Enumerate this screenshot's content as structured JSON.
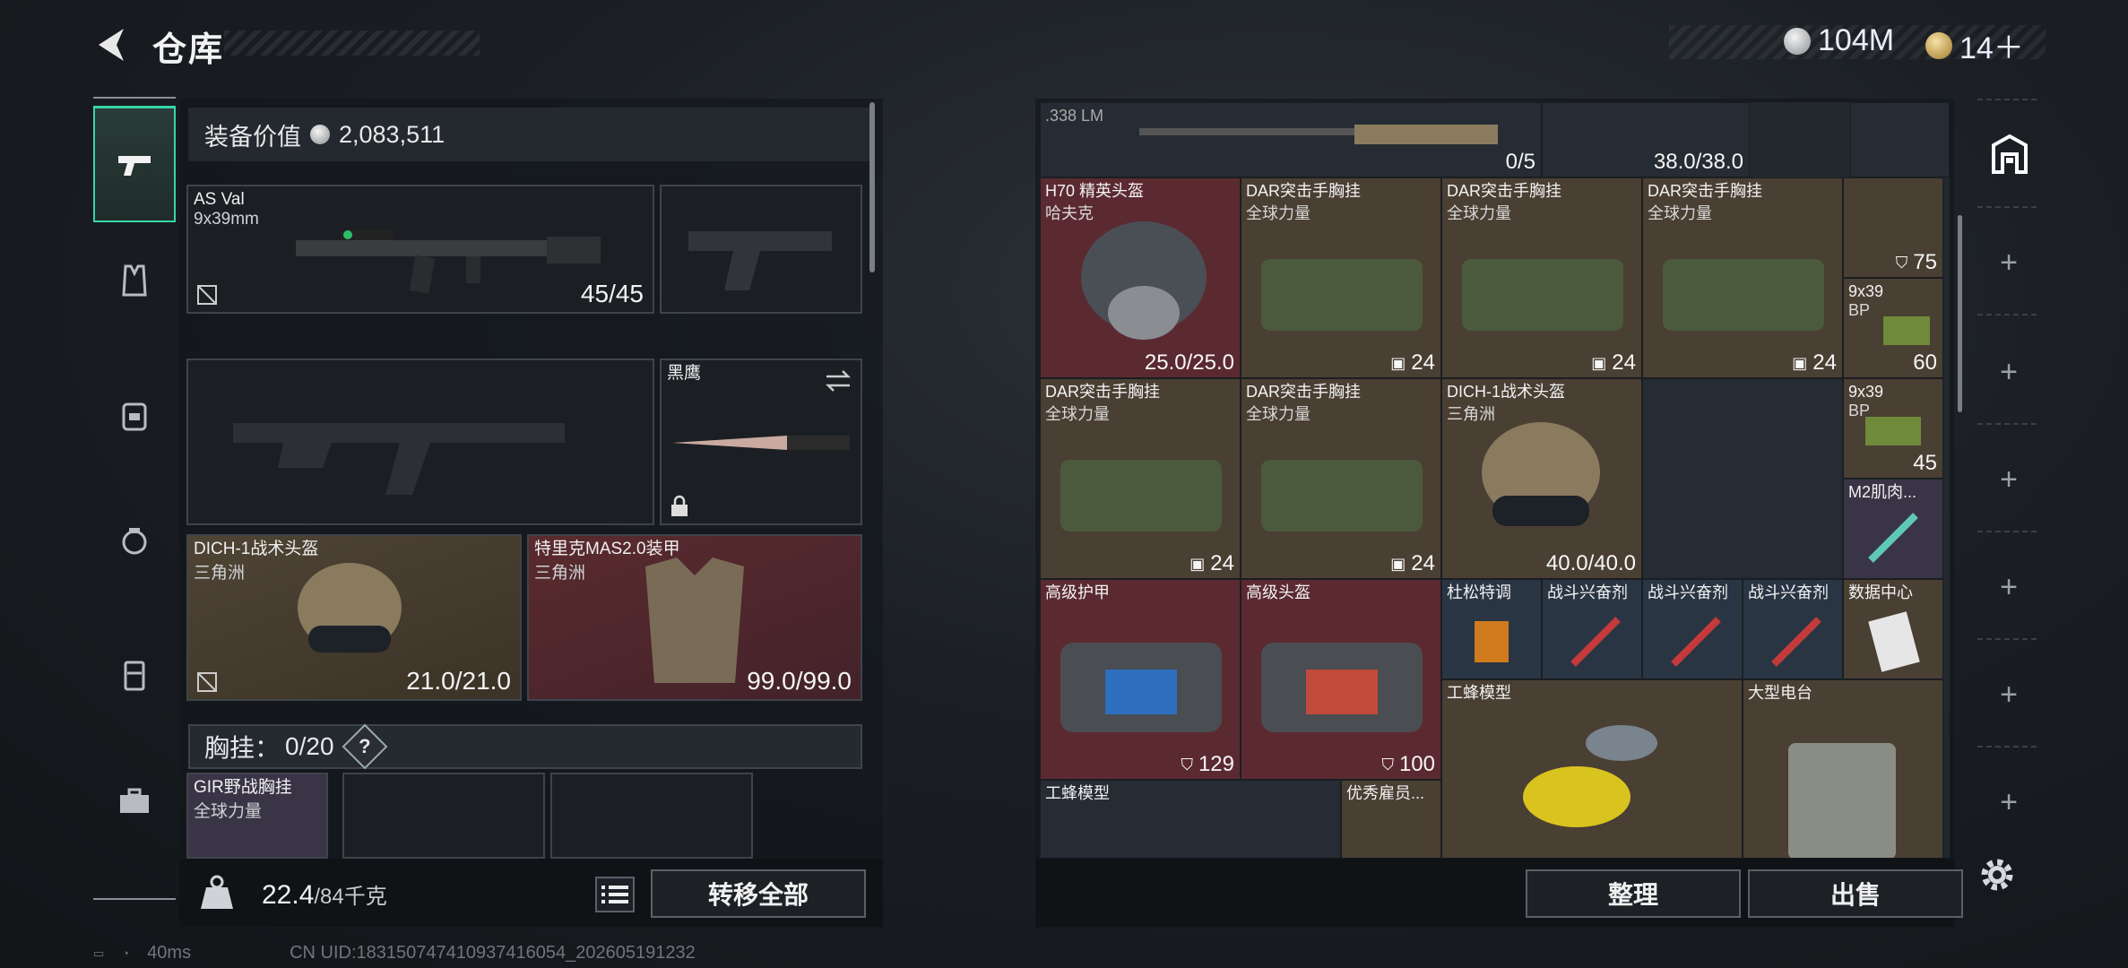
{
  "header": {
    "title": "仓库",
    "currency_silver": "104M",
    "currency_gold": "14＋"
  },
  "sidebar": {
    "items": [
      {
        "name": "pistol-icon",
        "active": true
      },
      {
        "name": "vest-icon"
      },
      {
        "name": "backpack-icon"
      },
      {
        "name": "pouch-icon"
      },
      {
        "name": "case-icon"
      },
      {
        "name": "toolbox-icon"
      }
    ]
  },
  "equipment": {
    "value_label": "装备价值",
    "value": "2,083,511",
    "primary": {
      "name": "AS Val",
      "ammo": "9x39mm",
      "count": "45/45"
    },
    "melee": {
      "name": "黑鹰"
    },
    "helmet": {
      "name": "DICH-1战术头盔",
      "sub": "三角洲",
      "count": "21.0/21.0"
    },
    "armor": {
      "name": "特里克MAS2.0装甲",
      "sub": "三角洲",
      "count": "99.0/99.0"
    },
    "chest_label": "胸挂：",
    "chest_value": "0/20",
    "chest_help": "?",
    "chest_item": {
      "name": "GIR野战胸挂",
      "sub": "全球力量"
    },
    "weight": "22.4",
    "weight_max": "/84千克",
    "transfer_all": "转移全部"
  },
  "storage": {
    "cells": [
      {
        "name": ".338 LM",
        "sub": "",
        "count": "0/5"
      },
      {
        "name": "",
        "sub": "",
        "count": "38.0/38.0"
      },
      {
        "name": "H70 精英头盔",
        "sub": "哈夫克",
        "count": "25.0/25.0"
      },
      {
        "name": "DAR突击手胸挂",
        "sub": "全球力量",
        "count": "24"
      },
      {
        "name": "DAR突击手胸挂",
        "sub": "全球力量",
        "count": "24"
      },
      {
        "name": "DAR突击手胸挂",
        "sub": "全球力量",
        "count": "24"
      },
      {
        "name": "",
        "sub": "",
        "count": "75"
      },
      {
        "name": "9x39",
        "sub": "BP",
        "count": "60"
      },
      {
        "name": "DAR突击手胸挂",
        "sub": "全球力量",
        "count": "24"
      },
      {
        "name": "DAR突击手胸挂",
        "sub": "全球力量",
        "count": "24"
      },
      {
        "name": "DICH-1战术头盔",
        "sub": "三角洲",
        "count": "40.0/40.0"
      },
      {
        "name": "9x39",
        "sub": "BP",
        "count": "45"
      },
      {
        "name": "M2肌肉...",
        "sub": "",
        "count": ""
      },
      {
        "name": "高级护甲",
        "sub": "",
        "count": "129"
      },
      {
        "name": "高级头盔",
        "sub": "",
        "count": "100"
      },
      {
        "name": "杜松特调",
        "sub": "",
        "count": ""
      },
      {
        "name": "战斗兴奋剂",
        "sub": "",
        "count": ""
      },
      {
        "name": "战斗兴奋剂",
        "sub": "",
        "count": ""
      },
      {
        "name": "战斗兴奋剂",
        "sub": "",
        "count": ""
      },
      {
        "name": "数据中心",
        "sub": "",
        "count": ""
      },
      {
        "name": "工蜂模型",
        "sub": "",
        "count": ""
      },
      {
        "name": "大型电台",
        "sub": "",
        "count": ""
      },
      {
        "name": "工蜂模型",
        "sub": "",
        "count": ""
      },
      {
        "name": "优秀雇员...",
        "sub": "",
        "count": ""
      }
    ],
    "sort_label": "整理",
    "sell_label": "出售"
  },
  "status": {
    "ping": "40ms",
    "uid": "CN UID:18315074741093741605​4_202605191232"
  },
  "colors": {
    "accent": "#38d6a8",
    "red_slot": "#5b2a30",
    "brown_slot": "#4a3f33"
  }
}
